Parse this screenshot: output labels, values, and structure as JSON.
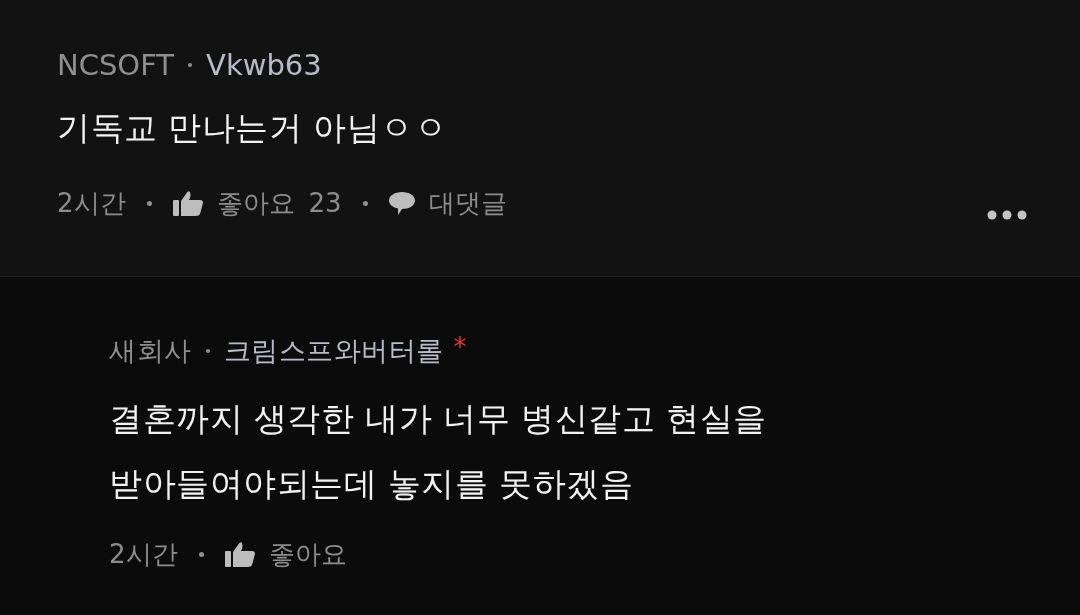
{
  "comments": [
    {
      "kind": "comment",
      "company": "NCSOFT",
      "author": "Vkwb63",
      "text": "기독교 만나는거 아님ㅇㅇ",
      "time": "2시간",
      "like": {
        "label": "좋아요",
        "count": "23"
      },
      "reply_label": "대댓글",
      "more_menu": true
    },
    {
      "kind": "reply",
      "company": "새회사",
      "author": "크림스프와버터롤",
      "author_mark": "*",
      "text": "결혼까지 생각한 내가 너무 병신같고 현실을 받아들여야되는데 놓지를 못하겠음",
      "time": "2시간",
      "like": {
        "label": "좋아요"
      }
    }
  ]
}
